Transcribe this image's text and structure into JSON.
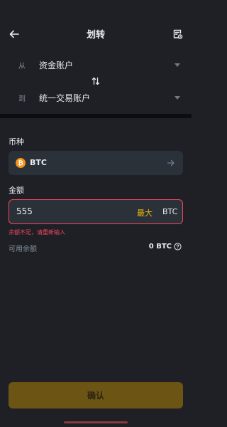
{
  "header": {
    "title": "划转",
    "back_icon": "arrow-left-icon",
    "record_icon": "transfer-record-icon"
  },
  "from_account": {
    "prefix": "从",
    "name": "资金账户"
  },
  "to_account": {
    "prefix": "到",
    "name": "统一交易账户"
  },
  "swap_icon": "swap-vertical-icon",
  "currency": {
    "label": "币种",
    "coin": "BTC",
    "coin_symbol": "₿",
    "coin_color": "#f7931a"
  },
  "amount": {
    "label": "金额",
    "value": "555",
    "max_label": "最大",
    "unit": "BTC",
    "error": "余额不足，请重新输入"
  },
  "available": {
    "label": "可用余额",
    "value": "0 BTC"
  },
  "confirm_label": "确认",
  "colors": {
    "background": "#1e2026",
    "accent": "#f0b90b",
    "error": "#f6465d",
    "field": "#2b3139"
  }
}
